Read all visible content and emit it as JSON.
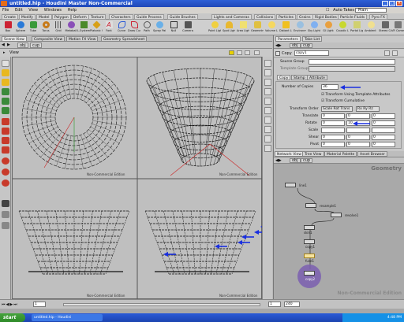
{
  "window": {
    "title": "untitled.hip - Houdini Master Non-Commercial"
  },
  "menubar": {
    "items": [
      "File",
      "Edit",
      "View",
      "Windows",
      "Help"
    ],
    "mode": "Auto Takes",
    "mode_value": "Main"
  },
  "shelf_tabs": [
    "Create",
    "Modify",
    "Model",
    "Polygon",
    "Deform",
    "Texture",
    "Characters",
    "Guide Process",
    "Guide Brushes",
    "Terrain FX",
    "Cloud FX",
    "Volume",
    "Lights and Cameras",
    "Collisions",
    "Particles",
    "Grains",
    "Rigid Bodies",
    "Particle Fluids",
    "Viscous Fluids",
    "Oceans",
    "Fluid Containers",
    "Populate Containers",
    "Container Tools",
    "Pyro FX"
  ],
  "shelf_tools": [
    "Box",
    "Sphere",
    "Tube",
    "Torus",
    "Grid",
    "Metaball",
    "L-System",
    "Platonic Solids",
    "Font",
    "Curve",
    "Draw Curve",
    "Path",
    "Spray Paint",
    "Null",
    "Camera",
    "Point Light",
    "Spot Light",
    "Area Light",
    "Geometry Light",
    "Volume Light",
    "Distant Light",
    "Environment",
    "Sky Light",
    "GI Light",
    "Caustic Light",
    "Portal Light",
    "Ambient Light",
    "Stereo Camera",
    "VR Camera",
    "Switcher",
    "Gamepad Camera"
  ],
  "pane_tabs": [
    "Scene View",
    "Composite View",
    "Motion FX View",
    "Geometry Spreadsheet"
  ],
  "path": {
    "level1": "obj",
    "level2": "cup"
  },
  "viewport": {
    "view_label": "View",
    "watermark": "Non-Commercial Edition"
  },
  "param": {
    "tabs": [
      "Parameters",
      "Take List"
    ],
    "path_obj": "obj",
    "path_node": "cup",
    "node_type": "Copy",
    "node_name": "copy1",
    "source_group_label": "Source Group",
    "template_group_label": "Template Group",
    "sub_tabs": [
      "Copy",
      "Stamp",
      "Attribute"
    ],
    "num_copies_label": "Number of Copies",
    "num_copies_value": "36",
    "opt1": "Transform Using Template Attributes",
    "opt2": "Transform Cumulative",
    "xform_order_label": "Transform Order",
    "xform_order_value": "Scale Rot Trans",
    "rot_order_value": "Rx Ry Rz",
    "translate_label": "Translate",
    "rotate_label": "Rotate",
    "rotate_y": "10",
    "scale_label": "Scale",
    "shear_label": "Shear",
    "pivot_label": "Pivot",
    "vals": [
      "0",
      "0",
      "0"
    ]
  },
  "network": {
    "tabs": [
      "Network View",
      "Tree View",
      "Material Palette",
      "Asset Browser"
    ],
    "path_obj": "obj",
    "path_node": "cup",
    "context": "Geometry",
    "watermark": "Non-Commercial Edition",
    "nodes": [
      "line1",
      "resample1",
      "revolve1",
      "skin1",
      "copy1",
      "fuse1",
      "copy2"
    ]
  },
  "timeline": {
    "frame": "1",
    "start": "1",
    "end": "240"
  },
  "taskbar": {
    "start": "start",
    "clock": "4:48 PM",
    "task": "untitled.hip - Houdini"
  },
  "colors": {
    "title": "#2d5fd6",
    "arrow": "#1a2fe0",
    "node_selected": "#f5e3a0",
    "node_display": "#7b5fb0"
  }
}
